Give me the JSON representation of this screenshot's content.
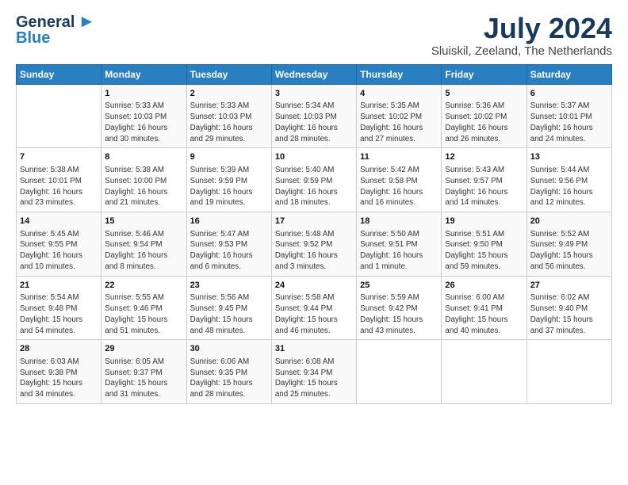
{
  "logo": {
    "line1": "General",
    "line2": "Blue"
  },
  "header": {
    "title": "July 2024",
    "subtitle": "Sluiskil, Zeeland, The Netherlands"
  },
  "days_of_week": [
    "Sunday",
    "Monday",
    "Tuesday",
    "Wednesday",
    "Thursday",
    "Friday",
    "Saturday"
  ],
  "weeks": [
    [
      {
        "day": "",
        "content": ""
      },
      {
        "day": "1",
        "content": "Sunrise: 5:33 AM\nSunset: 10:03 PM\nDaylight: 16 hours\nand 30 minutes."
      },
      {
        "day": "2",
        "content": "Sunrise: 5:33 AM\nSunset: 10:03 PM\nDaylight: 16 hours\nand 29 minutes."
      },
      {
        "day": "3",
        "content": "Sunrise: 5:34 AM\nSunset: 10:03 PM\nDaylight: 16 hours\nand 28 minutes."
      },
      {
        "day": "4",
        "content": "Sunrise: 5:35 AM\nSunset: 10:02 PM\nDaylight: 16 hours\nand 27 minutes."
      },
      {
        "day": "5",
        "content": "Sunrise: 5:36 AM\nSunset: 10:02 PM\nDaylight: 16 hours\nand 26 minutes."
      },
      {
        "day": "6",
        "content": "Sunrise: 5:37 AM\nSunset: 10:01 PM\nDaylight: 16 hours\nand 24 minutes."
      }
    ],
    [
      {
        "day": "7",
        "content": "Sunrise: 5:38 AM\nSunset: 10:01 PM\nDaylight: 16 hours\nand 23 minutes."
      },
      {
        "day": "8",
        "content": "Sunrise: 5:38 AM\nSunset: 10:00 PM\nDaylight: 16 hours\nand 21 minutes."
      },
      {
        "day": "9",
        "content": "Sunrise: 5:39 AM\nSunset: 9:59 PM\nDaylight: 16 hours\nand 19 minutes."
      },
      {
        "day": "10",
        "content": "Sunrise: 5:40 AM\nSunset: 9:59 PM\nDaylight: 16 hours\nand 18 minutes."
      },
      {
        "day": "11",
        "content": "Sunrise: 5:42 AM\nSunset: 9:58 PM\nDaylight: 16 hours\nand 16 minutes."
      },
      {
        "day": "12",
        "content": "Sunrise: 5:43 AM\nSunset: 9:57 PM\nDaylight: 16 hours\nand 14 minutes."
      },
      {
        "day": "13",
        "content": "Sunrise: 5:44 AM\nSunset: 9:56 PM\nDaylight: 16 hours\nand 12 minutes."
      }
    ],
    [
      {
        "day": "14",
        "content": "Sunrise: 5:45 AM\nSunset: 9:55 PM\nDaylight: 16 hours\nand 10 minutes."
      },
      {
        "day": "15",
        "content": "Sunrise: 5:46 AM\nSunset: 9:54 PM\nDaylight: 16 hours\nand 8 minutes."
      },
      {
        "day": "16",
        "content": "Sunrise: 5:47 AM\nSunset: 9:53 PM\nDaylight: 16 hours\nand 6 minutes."
      },
      {
        "day": "17",
        "content": "Sunrise: 5:48 AM\nSunset: 9:52 PM\nDaylight: 16 hours\nand 3 minutes."
      },
      {
        "day": "18",
        "content": "Sunrise: 5:50 AM\nSunset: 9:51 PM\nDaylight: 16 hours\nand 1 minute."
      },
      {
        "day": "19",
        "content": "Sunrise: 5:51 AM\nSunset: 9:50 PM\nDaylight: 15 hours\nand 59 minutes."
      },
      {
        "day": "20",
        "content": "Sunrise: 5:52 AM\nSunset: 9:49 PM\nDaylight: 15 hours\nand 56 minutes."
      }
    ],
    [
      {
        "day": "21",
        "content": "Sunrise: 5:54 AM\nSunset: 9:48 PM\nDaylight: 15 hours\nand 54 minutes."
      },
      {
        "day": "22",
        "content": "Sunrise: 5:55 AM\nSunset: 9:46 PM\nDaylight: 15 hours\nand 51 minutes."
      },
      {
        "day": "23",
        "content": "Sunrise: 5:56 AM\nSunset: 9:45 PM\nDaylight: 15 hours\nand 48 minutes."
      },
      {
        "day": "24",
        "content": "Sunrise: 5:58 AM\nSunset: 9:44 PM\nDaylight: 15 hours\nand 46 minutes."
      },
      {
        "day": "25",
        "content": "Sunrise: 5:59 AM\nSunset: 9:42 PM\nDaylight: 15 hours\nand 43 minutes."
      },
      {
        "day": "26",
        "content": "Sunrise: 6:00 AM\nSunset: 9:41 PM\nDaylight: 15 hours\nand 40 minutes."
      },
      {
        "day": "27",
        "content": "Sunrise: 6:02 AM\nSunset: 9:40 PM\nDaylight: 15 hours\nand 37 minutes."
      }
    ],
    [
      {
        "day": "28",
        "content": "Sunrise: 6:03 AM\nSunset: 9:38 PM\nDaylight: 15 hours\nand 34 minutes."
      },
      {
        "day": "29",
        "content": "Sunrise: 6:05 AM\nSunset: 9:37 PM\nDaylight: 15 hours\nand 31 minutes."
      },
      {
        "day": "30",
        "content": "Sunrise: 6:06 AM\nSunset: 9:35 PM\nDaylight: 15 hours\nand 28 minutes."
      },
      {
        "day": "31",
        "content": "Sunrise: 6:08 AM\nSunset: 9:34 PM\nDaylight: 15 hours\nand 25 minutes."
      },
      {
        "day": "",
        "content": ""
      },
      {
        "day": "",
        "content": ""
      },
      {
        "day": "",
        "content": ""
      }
    ]
  ]
}
